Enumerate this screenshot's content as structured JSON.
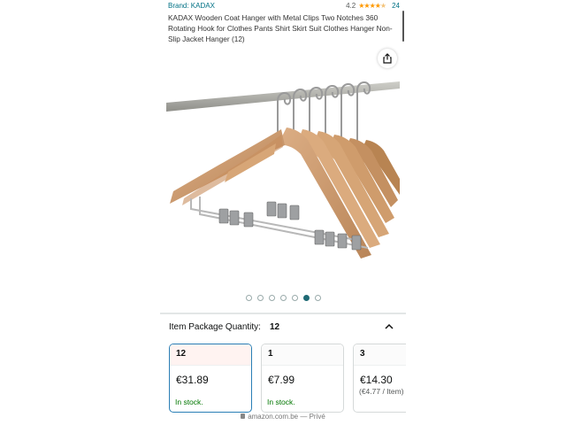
{
  "product": {
    "brand": "Brand: KADAX",
    "rating": "4.2",
    "stars_count": 4.2,
    "review_count": "24",
    "title": "KADAX Wooden Coat Hanger with Metal Clips Two Notches 360 Rotating Hook for Clothes Pants Shirt Skirt Suit Clothes Hanger Non-Slip Jacket Hanger (12)"
  },
  "icons": {
    "share": "share-icon",
    "chevron": "chevron-up-icon",
    "lock": "lock-icon"
  },
  "gallery": {
    "total_images": 7,
    "active_index": 5
  },
  "quantity": {
    "label": "Item Package Quantity:",
    "value": "12"
  },
  "options": [
    {
      "qty": "12",
      "price": "€31.89",
      "stock": "In stock.",
      "selected": true
    },
    {
      "qty": "1",
      "price": "€7.99",
      "stock": "In stock.",
      "selected": false
    },
    {
      "qty": "3",
      "price": "€14.30",
      "unit_price": "(€4.77 / Item)",
      "selected": false
    }
  ],
  "browser": {
    "url": "amazon.com.be",
    "mode": "— Privé"
  },
  "colors": {
    "link": "#007185",
    "star": "#ff9900",
    "in_stock": "#007600",
    "selected_border": "#2a7fb6",
    "active_dot": "#1f6a75"
  }
}
